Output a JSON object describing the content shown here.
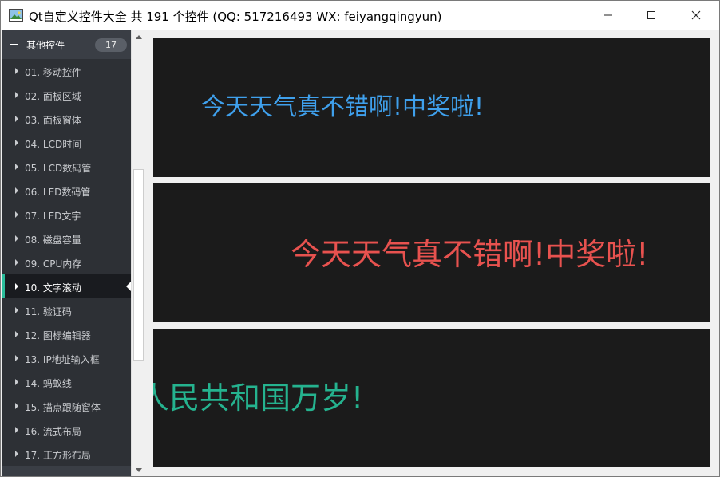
{
  "window": {
    "title": "Qt自定义控件大全 共 191 个控件 (QQ: 517216493 WX: feiyangqingyun)",
    "controls": {
      "minimize": "—",
      "maximize": "☐",
      "close": "✕"
    }
  },
  "sidebar": {
    "group": {
      "label": "其他控件",
      "count": "17"
    },
    "items": [
      {
        "label": "01. 移动控件"
      },
      {
        "label": "02. 面板区域"
      },
      {
        "label": "03. 面板窗体"
      },
      {
        "label": "04. LCD时间"
      },
      {
        "label": "05. LCD数码管"
      },
      {
        "label": "06. LED数码管"
      },
      {
        "label": "07. LED文字"
      },
      {
        "label": "08. 磁盘容量"
      },
      {
        "label": "09. CPU内存"
      },
      {
        "label": "10. 文字滚动"
      },
      {
        "label": "11. 验证码"
      },
      {
        "label": "12. 图标编辑器"
      },
      {
        "label": "13. IP地址输入框"
      },
      {
        "label": "14. 蚂蚁线"
      },
      {
        "label": "15. 描点跟随窗体"
      },
      {
        "label": "16. 流式布局"
      },
      {
        "label": "17. 正方形布局"
      }
    ],
    "selected_index": 9
  },
  "panels": [
    {
      "text": "今天天气真不错啊!中奖啦!",
      "color": "#3fa0ec"
    },
    {
      "text": "今天天气真不错啊!中奖啦!",
      "color": "#e8524f"
    },
    {
      "text": "人民共和国万岁!",
      "color": "#25b38f"
    }
  ],
  "colors": {
    "sidebar_bg": "#2d3035",
    "selected_bg": "#191b1f",
    "accent": "#2bbd9b",
    "panel_bg": "#1b1b1b"
  }
}
